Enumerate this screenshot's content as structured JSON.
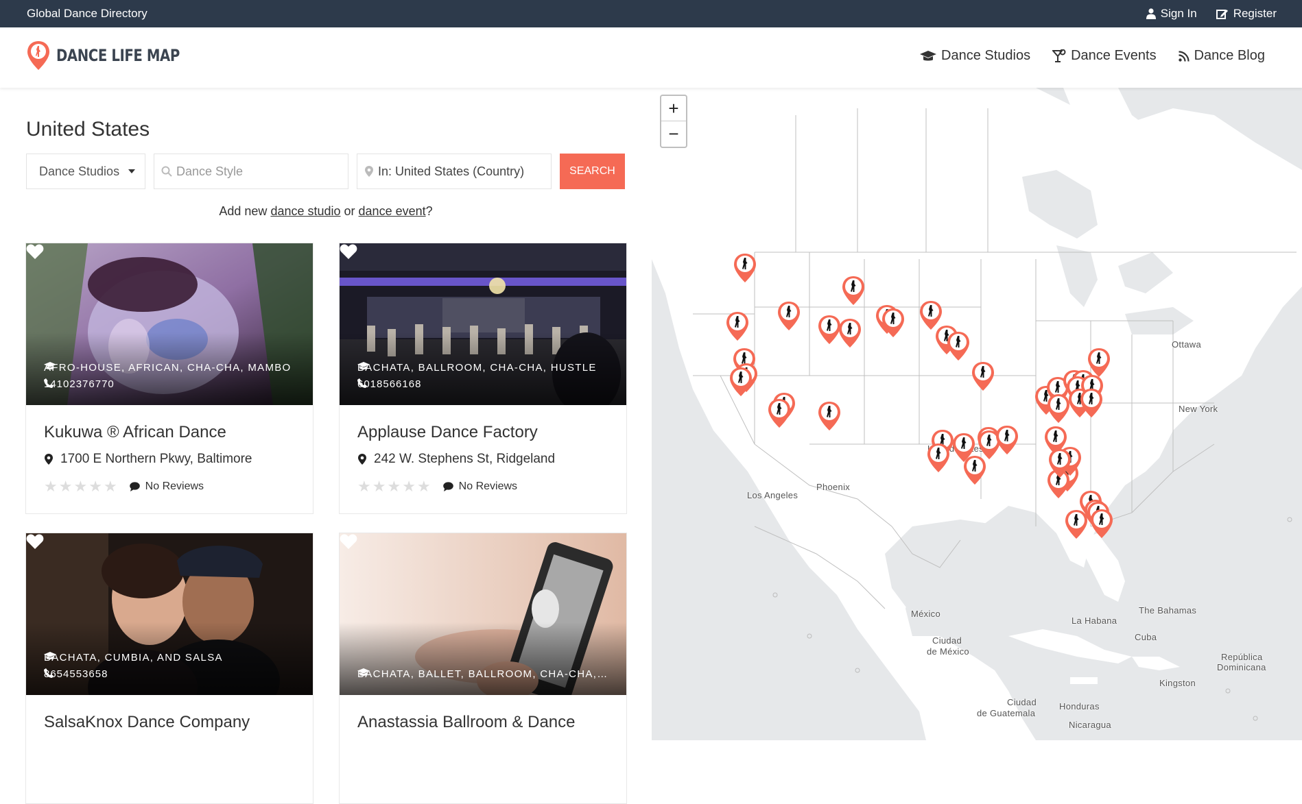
{
  "topbar": {
    "site_name": "Global Dance Directory",
    "sign_in": "Sign In",
    "register": "Register"
  },
  "header": {
    "logo_text": "DANCE LIFE MAP",
    "nav": [
      {
        "label": "Dance Studios",
        "icon": "graduation-cap-icon"
      },
      {
        "label": "Dance Events",
        "icon": "cocktail-icon"
      },
      {
        "label": "Dance Blog",
        "icon": "rss-icon"
      }
    ]
  },
  "page": {
    "title": "United States"
  },
  "search": {
    "category_selected": "Dance Studios",
    "style_placeholder": "Dance Style",
    "location_value": "In: United States (Country)",
    "button_label": "SEARCH"
  },
  "addnew": {
    "prefix": "Add new ",
    "studio_link": "dance studio",
    "or": " or ",
    "event_link": "dance event",
    "suffix": "?"
  },
  "listings": [
    {
      "name": "Kukuwa ® African Dance",
      "tags": "AFRO-HOUSE, AFRICAN, CHA-CHA, MAMBO",
      "phone": "14102376770",
      "address": "1700 E Northern Pkwy, Baltimore",
      "reviews": "No Reviews",
      "rating": 0
    },
    {
      "name": "Applause Dance Factory",
      "tags": "BACHATA, BALLROOM, CHA-CHA, HUSTLE",
      "phone": "6018566168",
      "address": "242 W. Stephens St, Ridgeland",
      "reviews": "No Reviews",
      "rating": 0
    },
    {
      "name": "SalsaKnox Dance Company",
      "tags": "BACHATA, CUMBIA, AND SALSA",
      "phone": "8654553658"
    },
    {
      "name": "Anastassia Ballroom & Dance",
      "tags": "BACHATA, BALLET, BALLROOM, CHA-CHA, SALSA"
    }
  ],
  "map": {
    "zoom_in": "+",
    "zoom_out": "−",
    "labels": {
      "ottawa": "Ottawa",
      "new_york": "New York",
      "united_states": "United States",
      "los_angeles": "Los Angeles",
      "phoenix": "Phoenix",
      "mexico": "México",
      "ciudad_de_mexico_1": "Ciudad",
      "ciudad_de_mexico_2": "de México",
      "la_habana": "La Habana",
      "the_bahamas": "The Bahamas",
      "cuba": "Cuba",
      "republica_1": "República",
      "republica_2": "Dominicana",
      "kingston": "Kingston",
      "guatemala_1": "Ciudad",
      "guatemala_2": "de Guatemala",
      "honduras": "Honduras",
      "nicaragua": "Nicaragua"
    },
    "accent_color": "#f56a55"
  }
}
